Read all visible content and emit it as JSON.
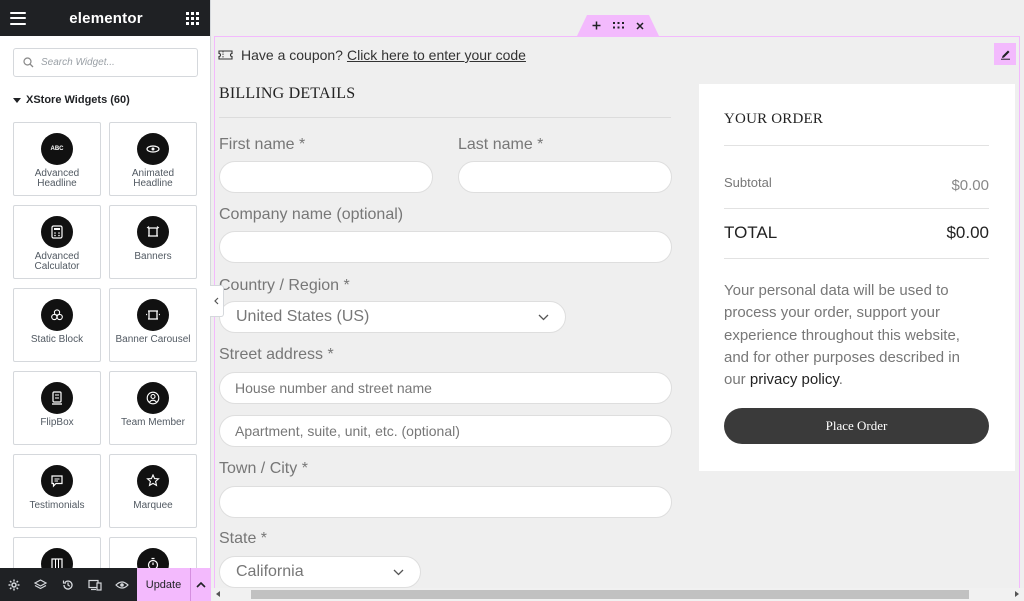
{
  "panel": {
    "brand": "elementor",
    "search_placeholder": "Search Widget...",
    "category_label": "XStore Widgets (60)",
    "widgets": [
      {
        "line1": "Advanced",
        "line2": "Headline",
        "icon": "abc-icon"
      },
      {
        "line1": "Animated",
        "line2": "Headline",
        "icon": "eye-icon"
      },
      {
        "line1": "Advanced",
        "line2": "Calculator",
        "icon": "calculator-icon"
      },
      {
        "line1": "Banners",
        "line2": "",
        "icon": "banner-icon"
      },
      {
        "line1": "Static Block",
        "line2": "",
        "icon": "blocks-icon"
      },
      {
        "line1": "Banner Carousel",
        "line2": "",
        "icon": "banner-carousel-icon"
      },
      {
        "line1": "FlipBox",
        "line2": "",
        "icon": "flipbox-icon"
      },
      {
        "line1": "Team Member",
        "line2": "",
        "icon": "team-member-icon"
      },
      {
        "line1": "Testimonials",
        "line2": "",
        "icon": "testimonial-icon"
      },
      {
        "line1": "Marquee",
        "line2": "",
        "icon": "star-badge-icon"
      }
    ],
    "footer": {
      "update_label": "Update"
    },
    "widget_icon_abc_text": "ABC"
  },
  "preview": {
    "coupon_text": "Have a coupon?",
    "coupon_link": "Click here to enter your code",
    "billing_title": "BILLING DETAILS",
    "fields": {
      "first_name_label": "First name *",
      "last_name_label": "Last name *",
      "company_label": "Company name (optional)",
      "country_label": "Country / Region *",
      "country_value": "United States (US)",
      "street_label": "Street address *",
      "street_placeholder_1": "House number and street name",
      "street_placeholder_2": "Apartment, suite, unit, etc. (optional)",
      "town_label": "Town / City *",
      "state_label": "State *",
      "state_value": "California"
    },
    "order": {
      "title": "YOUR ORDER",
      "subtotal_label": "Subtotal",
      "subtotal_value": "$0.00",
      "total_label": "TOTAL",
      "total_value": "$0.00",
      "privacy_text": "Your personal data will be used to process your order, support your experience throughout this website, and for other purposes described in our",
      "privacy_link": "privacy policy",
      "privacy_end": ".",
      "place_order_label": "Place Order"
    }
  },
  "colors": {
    "accent_pink": "#f3bafd",
    "panel_dark": "#1f2124",
    "button_dark": "#3a3a3a"
  }
}
